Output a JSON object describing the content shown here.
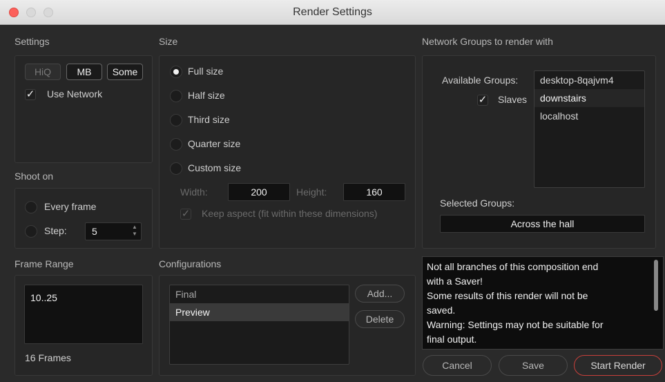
{
  "window": {
    "title": "Render Settings"
  },
  "settings": {
    "heading": "Settings",
    "toggles": [
      {
        "label": "HiQ",
        "state": "off"
      },
      {
        "label": "MB",
        "state": "on"
      },
      {
        "label": "Some",
        "state": "on"
      }
    ],
    "use_network": {
      "label": "Use Network",
      "checked": true
    }
  },
  "shoot_on": {
    "heading": "Shoot on",
    "every_frame": {
      "label": "Every frame",
      "selected": false
    },
    "step": {
      "label": "Step:",
      "selected": false,
      "value": "5"
    }
  },
  "frame_range": {
    "heading": "Frame Range",
    "value": "10..25",
    "summary": "16 Frames"
  },
  "size": {
    "heading": "Size",
    "options": [
      {
        "label": "Full size",
        "selected": true
      },
      {
        "label": "Half size",
        "selected": false
      },
      {
        "label": "Third size",
        "selected": false
      },
      {
        "label": "Quarter size",
        "selected": false
      },
      {
        "label": "Custom size",
        "selected": false
      }
    ],
    "width_label": "Width:",
    "width_value": "200",
    "height_label": "Height:",
    "height_value": "160",
    "keep_aspect": {
      "label": "Keep aspect (fit within these dimensions)",
      "checked": true,
      "enabled": false
    }
  },
  "configurations": {
    "heading": "Configurations",
    "items": [
      "Final",
      "Preview"
    ],
    "selected": "Preview",
    "add_label": "Add...",
    "delete_label": "Delete"
  },
  "network": {
    "heading": "Network Groups to render with",
    "available_label": "Available Groups:",
    "available_groups": [
      "desktop-8qajvm4",
      "downstairs",
      "localhost"
    ],
    "slaves": {
      "label": "Slaves",
      "checked": true
    },
    "selected_label": "Selected Groups:",
    "selected_value": "Across the hall"
  },
  "message": {
    "lines": [
      "Not all branches of this composition end",
      "with a Saver!",
      "Some results of this render will not be",
      "saved.",
      "Warning: Settings may not be suitable for",
      "final output."
    ]
  },
  "actions": {
    "cancel_label": "Cancel",
    "save_label": "Save",
    "start_label": "Start Render"
  },
  "colors": {
    "background": "#2a2a2a",
    "accent_red": "#c9403b",
    "close_button": "#fc605b"
  }
}
